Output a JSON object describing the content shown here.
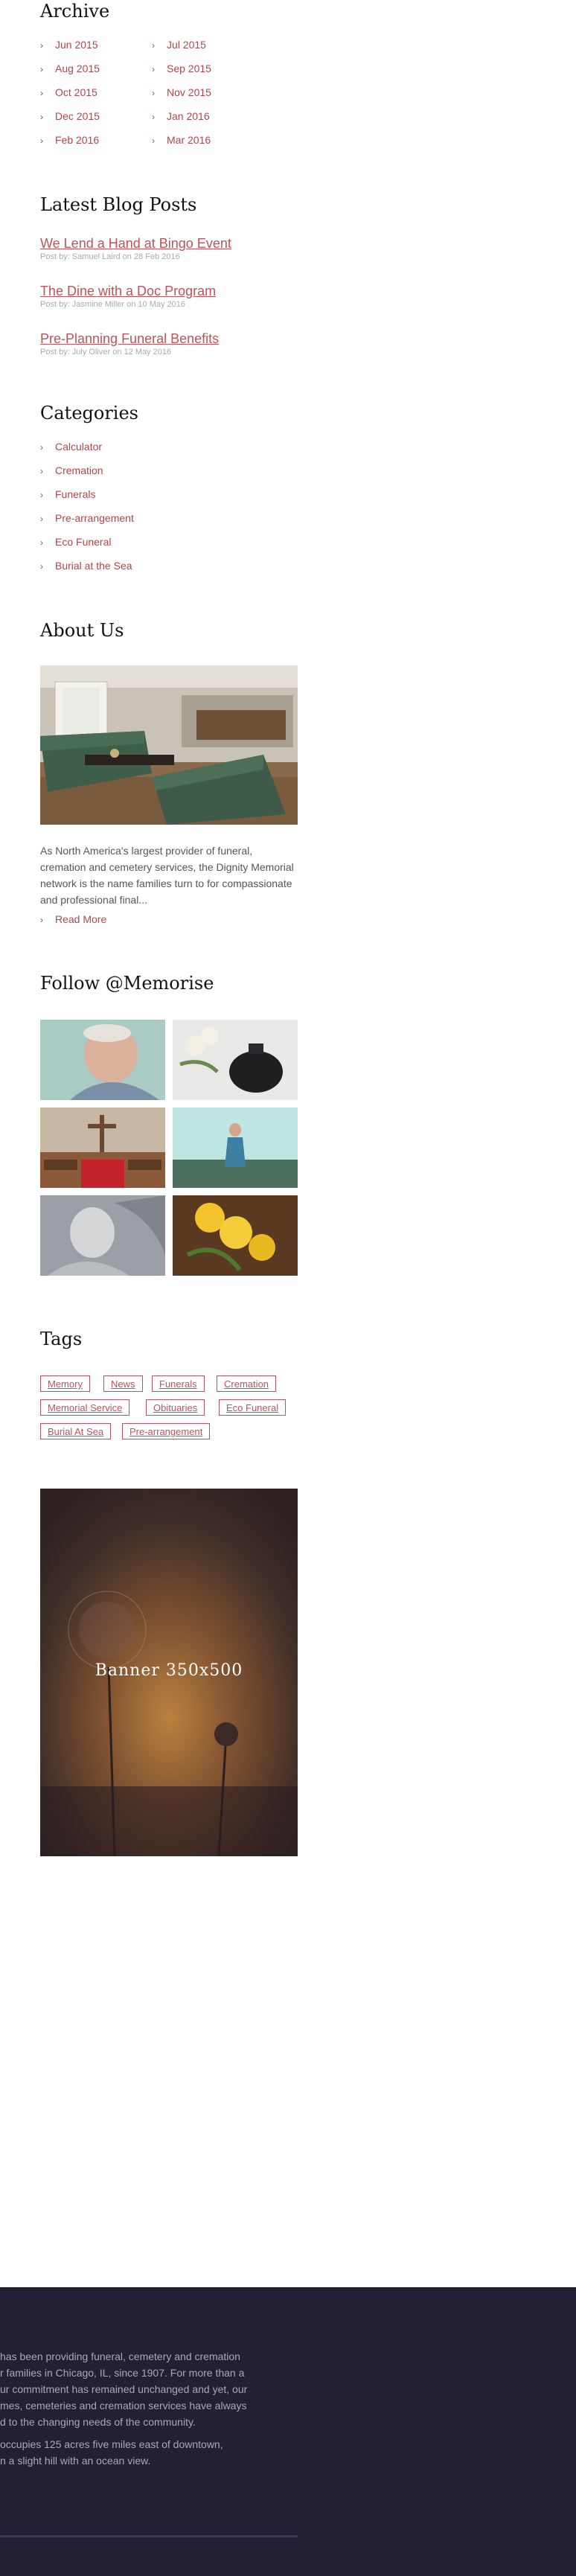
{
  "archive": {
    "title": "Archive",
    "left": [
      "Jun 2015",
      "Aug 2015",
      "Oct 2015",
      "Dec 2015",
      "Feb 2016"
    ],
    "right": [
      "Jul 2015",
      "Sep 2015",
      "Nov 2015",
      "Jan 2016",
      "Mar 2016"
    ]
  },
  "blog": {
    "title": "Latest Blog Posts",
    "posts": [
      {
        "title": "We Lend a Hand at Bingo Event",
        "meta": "Post by: Samuel Laird on  28 Feb 2016"
      },
      {
        "title": "The Dine with a Doc Program",
        "meta": "Post by: Jasmine Miller on  10 May 2016"
      },
      {
        "title": "Pre-Planning Funeral Benefits",
        "meta": "Post by: July Oliver on  12 May 2016"
      }
    ]
  },
  "categories": {
    "title": "Categories",
    "items": [
      "Calculator",
      "Cremation",
      "Funerals",
      "Pre-arrangement",
      "Eco Funeral",
      "Burial at the Sea"
    ]
  },
  "about": {
    "title": "About Us",
    "text": "As North America's largest provider of funeral, cremation and cemetery services,  the Dignity Memorial network is the name families turn to for compassionate and professional final...",
    "read_more": "Read More"
  },
  "follow": {
    "title": "Follow @Memorise"
  },
  "tags": {
    "title": "Tags",
    "items": [
      "Memory",
      "News",
      "Funerals",
      "Cremation",
      "Memorial Service",
      "Obituaries",
      "Eco Funeral",
      "Burial At Sea",
      "Pre-arrangement"
    ]
  },
  "banner": {
    "text": "Banner 350x500"
  },
  "footer": {
    "lines1": [
      "has been providing funeral, cemetery and cremation",
      "r families in Chicago, IL, since 1907. For more than a",
      "ur commitment has remained unchanged and yet, our",
      "mes, cemeteries and cremation services have always",
      "d to the changing needs of the community."
    ],
    "lines2": [
      "occupies 125 acres five miles east of downtown,",
      "n a slight hill with an ocean view."
    ]
  },
  "colors": {
    "accent": "#c0525a",
    "footer_bg": "#222034"
  }
}
